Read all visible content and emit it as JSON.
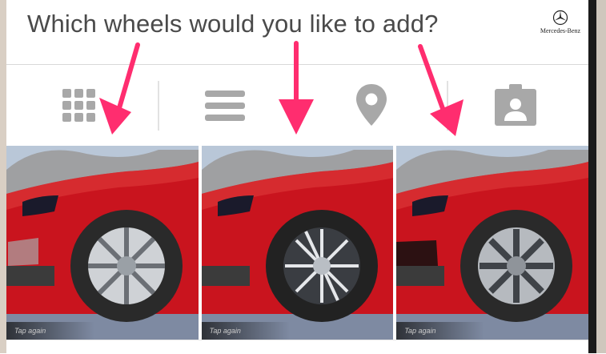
{
  "header": {
    "title": "Which wheels would you like to add?",
    "brand": "Mercedes-Benz"
  },
  "toolbar": {
    "icons": [
      "grid-view-icon",
      "list-view-icon",
      "location-pin-icon",
      "contact-card-icon"
    ]
  },
  "wheels": [
    {
      "tag": "Tap again"
    },
    {
      "tag": "Tap again"
    },
    {
      "tag": "Tap again"
    }
  ],
  "colors": {
    "accent_arrow": "#ff2d6f",
    "icon_gray": "#a8a8a8",
    "car_red": "#d01a22"
  }
}
